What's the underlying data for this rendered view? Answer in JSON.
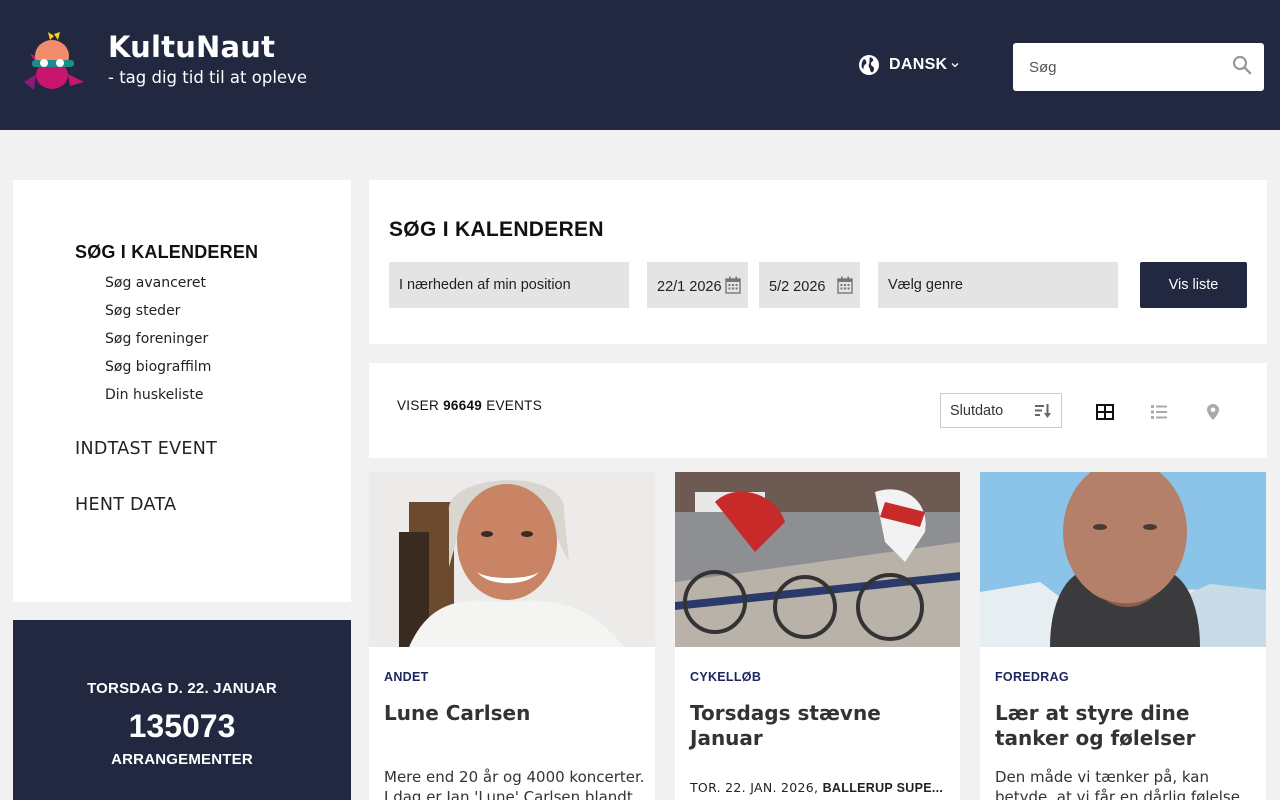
{
  "header": {
    "brand": "KultuNaut",
    "tagline": "- tag dig tid til at opleve",
    "language": "DANSK",
    "search_placeholder": "Søg"
  },
  "sidebar": {
    "heading": "SØG I KALENDEREN",
    "sub_items": [
      "Søg avanceret",
      "Søg steder",
      "Søg foreninger",
      "Søg biograffilm",
      "Din huskeliste"
    ],
    "main_items": [
      "INDTAST EVENT",
      "HENT DATA"
    ]
  },
  "stats": {
    "date": "TORSDAG D. 22. JANUAR",
    "count": "135073",
    "unit": "ARRANGEMENTER"
  },
  "search_panel": {
    "title": "SØG I KALENDEREN",
    "location": "I nærheden af min position",
    "date_from": "22/1 2026",
    "date_to": "5/2 2026",
    "genre": "Vælg genre",
    "button": "Vis liste"
  },
  "results": {
    "prefix": "VISER",
    "count": "96649",
    "suffix": "EVENTS",
    "sort": "Slutdato"
  },
  "cards": [
    {
      "genre": "ANDET",
      "title": "Lune Carlsen",
      "desc": "Mere end 20 år og 4000 koncerter. I dag er Jan 'Lune' Carlsen blandt"
    },
    {
      "genre": "CYKELLØB",
      "title": "Torsdags stævne Januar",
      "date": "TOR. 22. JAN. 2026,",
      "venue": "BALLERUP SUPE..."
    },
    {
      "genre": "FOREDRAG",
      "title": "Lær at styre dine tanker og følelser",
      "desc": "Den måde vi tænker på, kan betyde, at vi får en dårlig følelse"
    }
  ],
  "colors": {
    "navy": "#212840",
    "genre_blue": "#1d2660",
    "background": "#f1f1f1"
  },
  "icons": [
    "logo-mascot",
    "globe-icon",
    "chevron-down-icon",
    "search-icon",
    "calendar-icon",
    "sort-icon",
    "grid-view-icon",
    "list-view-icon",
    "map-pin-icon"
  ]
}
